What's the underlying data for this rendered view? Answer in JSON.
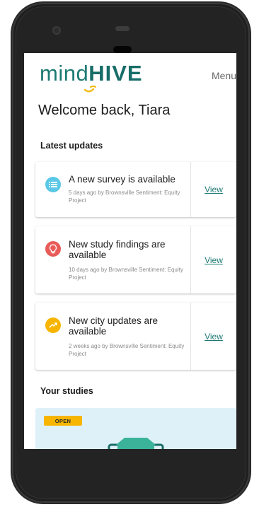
{
  "header": {
    "logo_light": "mind",
    "logo_bold": "HIVE",
    "menu_label": "Menu"
  },
  "welcome": "Welcome back, Tiara",
  "updates": {
    "section_title": "Latest updates",
    "items": [
      {
        "icon": "list-icon",
        "icon_color": "#5ac8e6",
        "title": "A new survey is available",
        "meta": "5 days ago by Brownsville Sentiment: Equity Project",
        "action": "View"
      },
      {
        "icon": "lightbulb-icon",
        "icon_color": "#e85b59",
        "title": "New study findings are available",
        "meta": "10 days ago by Brownsville Sentiment: Equity Project",
        "action": "View"
      },
      {
        "icon": "trending-up-icon",
        "icon_color": "#f7b500",
        "title": "New city updates are available",
        "meta": "2 weeks ago by Brownsville Sentiment: Equity Project",
        "action": "View"
      }
    ]
  },
  "studies": {
    "section_title": "Your studies",
    "first_badge": "OPEN"
  },
  "colors": {
    "brand": "#1d7a73",
    "accent": "#f7b500",
    "study_bg": "#dff1f8"
  }
}
